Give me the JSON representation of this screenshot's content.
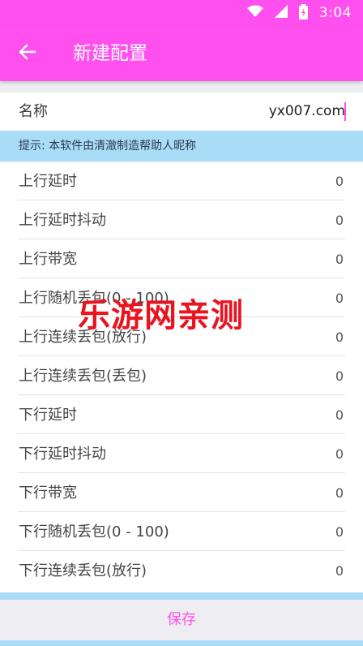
{
  "status_bar": {
    "time": "3:04",
    "wifi_icon": "wifi-icon",
    "signal_icon": "signal-icon",
    "battery_icon": "battery-charging-icon"
  },
  "app_bar": {
    "title": "新建配置",
    "back_icon": "arrow-left-icon"
  },
  "name_field": {
    "label": "名称",
    "value": "yx007.com"
  },
  "hint": "提示: 本软件由清澈制造帮助人昵称",
  "settings": [
    {
      "label": "上行延时",
      "value": "0"
    },
    {
      "label": "上行延时抖动",
      "value": "0"
    },
    {
      "label": "上行带宽",
      "value": "0"
    },
    {
      "label": "上行随机丢包(0 - 100)",
      "value": "0"
    },
    {
      "label": "上行连续丢包(放行)",
      "value": "0"
    },
    {
      "label": "上行连续丢包(丢包)",
      "value": "0"
    },
    {
      "label": "下行延时",
      "value": "0"
    },
    {
      "label": "下行延时抖动",
      "value": "0"
    },
    {
      "label": "下行带宽",
      "value": "0"
    },
    {
      "label": "下行随机丢包(0 - 100)",
      "value": "0"
    },
    {
      "label": "下行连续丢包(放行)",
      "value": "0"
    }
  ],
  "watermark": "乐游网亲测",
  "save_label": "保存",
  "colors": {
    "accent": "#ff50ef",
    "hint_background": "#a9dcf7",
    "watermark": "#e8141f"
  }
}
